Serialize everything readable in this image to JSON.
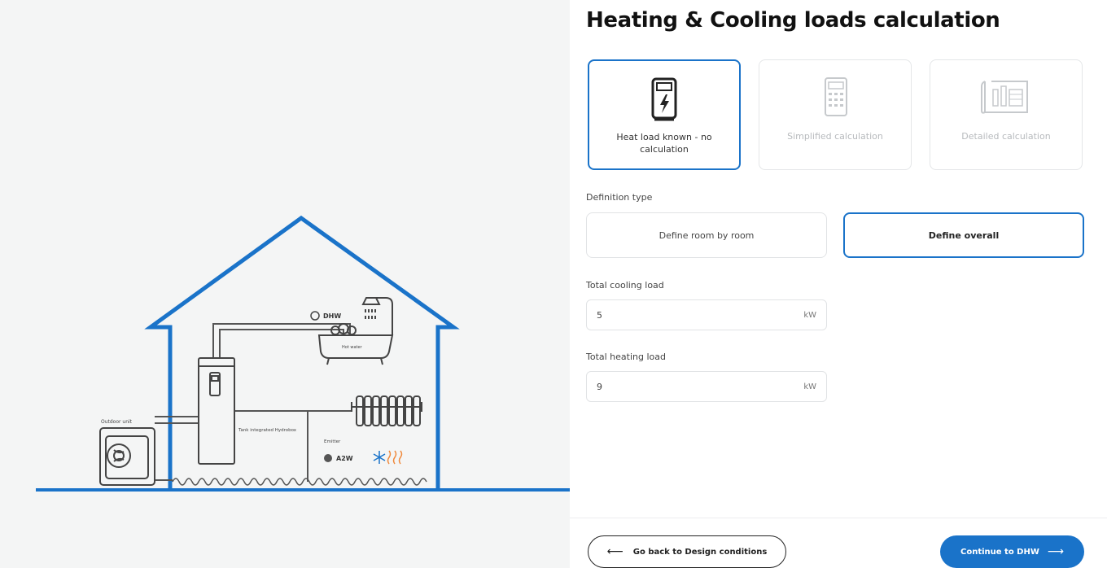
{
  "title": "Heating & Cooling loads calculation",
  "calc_options": [
    {
      "label": "Heat load known - no calculation",
      "icon": "power-unit-icon",
      "selected": true
    },
    {
      "label": "Simplified calculation",
      "icon": "calculator-icon",
      "selected": false
    },
    {
      "label": "Detailed calculation",
      "icon": "blueprint-icon",
      "selected": false
    }
  ],
  "definition": {
    "label": "Definition type",
    "options": [
      {
        "label": "Define room by room",
        "selected": false
      },
      {
        "label": "Define overall",
        "selected": true
      }
    ]
  },
  "cooling": {
    "label": "Total cooling load",
    "value": "5",
    "unit": "kW"
  },
  "heating": {
    "label": "Total heating load",
    "value": "9",
    "unit": "kW"
  },
  "footer": {
    "back_label": "Go back to Design conditions",
    "continue_label": "Continue to DHW"
  },
  "illustration": {
    "dhw_label": "DHW",
    "hot_water_label": "Hot water",
    "outdoor_unit_label": "Outdoor unit",
    "tank_label": "Tank integrated Hydrobox",
    "emitter_label": "Emitter",
    "a2w_label": "A2W",
    "accent_color": "#1a73c9",
    "heat_color": "#f0883a"
  }
}
